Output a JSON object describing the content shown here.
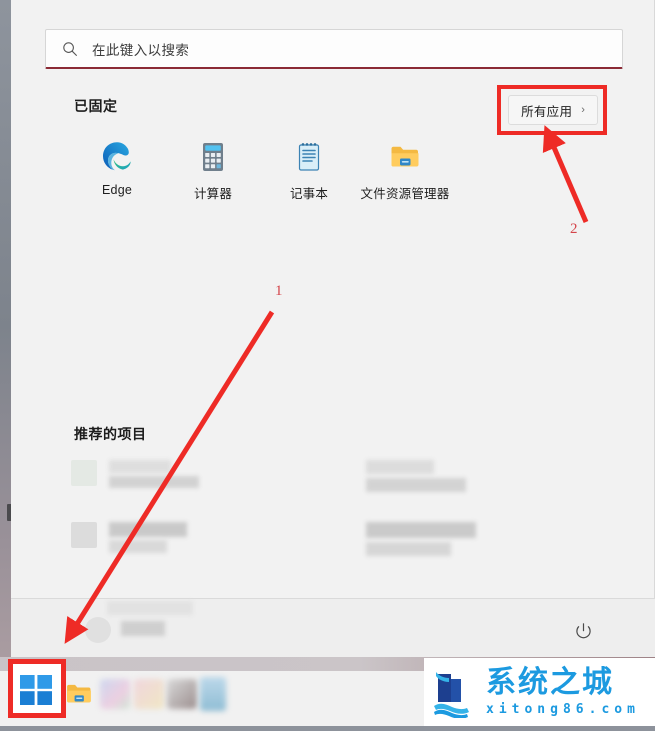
{
  "desktop": {
    "left_edge_marker": "desktop-icon-sliver"
  },
  "start_menu": {
    "search": {
      "placeholder": "在此键入以搜索",
      "value": "",
      "icon": "search-icon",
      "underline_color": "#8b2a35"
    },
    "pinned": {
      "title": "已固定",
      "all_apps": {
        "label": "所有应用",
        "chevron": "›",
        "highlight_color": "#ee2b26"
      },
      "apps": [
        {
          "label": "Edge",
          "icon": "edge-icon"
        },
        {
          "label": "计算器",
          "icon": "calculator-icon"
        },
        {
          "label": "记事本",
          "icon": "notepad-icon"
        },
        {
          "label": "文件资源管理器",
          "icon": "file-explorer-icon"
        }
      ]
    },
    "recommended": {
      "title": "推荐的项目",
      "items_redacted": true,
      "item_count": 4
    },
    "bottom_bar": {
      "account": {
        "name": "",
        "redacted": true,
        "icon": "avatar-icon"
      },
      "power": {
        "label": "",
        "icon": "power-icon"
      }
    }
  },
  "taskbar": {
    "start": {
      "label": "",
      "icon": "windows-start-icon",
      "highlight_color": "#ee2b26"
    },
    "items": [
      {
        "icon": "file-explorer-icon",
        "redacted": false
      },
      {
        "icon": "app-icon-redacted",
        "redacted": true
      },
      {
        "icon": "app-icon-redacted",
        "redacted": true
      },
      {
        "icon": "app-icon-redacted",
        "redacted": true
      },
      {
        "icon": "app-icon-redacted",
        "redacted": true
      }
    ]
  },
  "annotations": {
    "color": "#ee2b26",
    "markers": [
      {
        "label": "1",
        "target": "taskbar-start-button"
      },
      {
        "label": "2",
        "target": "all-apps-button"
      }
    ]
  },
  "watermark": {
    "title": "系统之城",
    "subtitle": "xitong86.com",
    "color": "#1c9ae0"
  }
}
